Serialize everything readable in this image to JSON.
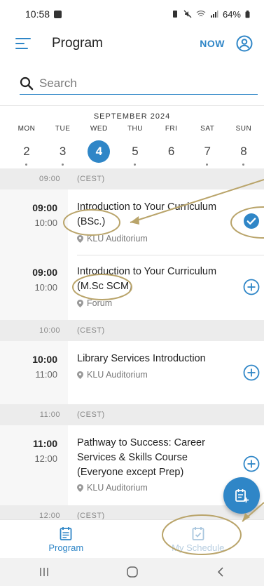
{
  "status": {
    "time": "10:58",
    "battery": "64%"
  },
  "header": {
    "title": "Program",
    "now_label": "NOW"
  },
  "search": {
    "placeholder": "Search"
  },
  "calendar": {
    "month": "SEPTEMBER 2024",
    "days": [
      {
        "dow": "MON",
        "num": "2",
        "selected": false,
        "dot": true
      },
      {
        "dow": "TUE",
        "num": "3",
        "selected": false,
        "dot": true
      },
      {
        "dow": "WED",
        "num": "4",
        "selected": true,
        "dot": false
      },
      {
        "dow": "THU",
        "num": "5",
        "selected": false,
        "dot": true
      },
      {
        "dow": "FRI",
        "num": "6",
        "selected": false,
        "dot": false
      },
      {
        "dow": "SAT",
        "num": "7",
        "selected": false,
        "dot": true
      },
      {
        "dow": "SUN",
        "num": "8",
        "selected": false,
        "dot": true
      }
    ]
  },
  "schedule": {
    "hour_blocks": [
      {
        "time": "09:00",
        "tz": "(CEST)"
      },
      {
        "time": "10:00",
        "tz": "(CEST)"
      },
      {
        "time": "11:00",
        "tz": "(CEST)"
      },
      {
        "time": "12:00",
        "tz": "(CEST)"
      }
    ],
    "events": [
      {
        "start": "09:00",
        "end": "10:00",
        "title_lines": [
          "Introduction to Your Curriculum",
          "(BSc.)"
        ],
        "location": "KLU Auditorium",
        "added": true
      },
      {
        "start": "09:00",
        "end": "10:00",
        "title_lines": [
          "Introduction to Your Curriculum",
          "(M.Sc SCM)"
        ],
        "location": "Forum",
        "added": false
      },
      {
        "start": "10:00",
        "end": "11:00",
        "title_lines": [
          "Library Services Introduction"
        ],
        "location": "KLU Auditorium",
        "added": false
      },
      {
        "start": "11:00",
        "end": "12:00",
        "title_lines": [
          "Pathway to Success: Career",
          "Services & Skills Course",
          "(Everyone except Prep)"
        ],
        "location": "KLU Auditorium",
        "added": false
      }
    ]
  },
  "bottom_nav": {
    "program_label": "Program",
    "my_schedule_label": "My Schedule"
  },
  "colors": {
    "accent": "#2f86c7",
    "annotation": "#b9a46a"
  }
}
